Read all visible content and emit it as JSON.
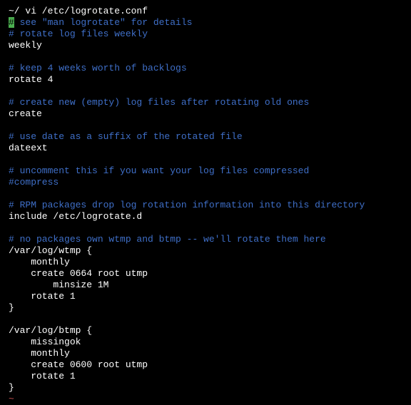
{
  "prompt": "~/ vi /etc/logrotate.conf",
  "cursor_char": "#",
  "l1_rest": " see \"man logrotate\" for details",
  "l2": "# rotate log files weekly",
  "l3": "weekly",
  "l4": "# keep 4 weeks worth of backlogs",
  "l5": "rotate 4",
  "l6": "# create new (empty) log files after rotating old ones",
  "l7": "create",
  "l8": "# use date as a suffix of the rotated file",
  "l9": "dateext",
  "l10": "# uncomment this if you want your log files compressed",
  "l11": "#compress",
  "l12": "# RPM packages drop log rotation information into this directory",
  "l13": "include /etc/logrotate.d",
  "l14": "# no packages own wtmp and btmp -- we'll rotate them here",
  "l15": "/var/log/wtmp {",
  "l16": "    monthly",
  "l17": "    create 0664 root utmp",
  "l18": "        minsize 1M",
  "l19": "    rotate 1",
  "l20": "}",
  "l21": "/var/log/btmp {",
  "l22": "    missingok",
  "l23": "    monthly",
  "l24": "    create 0600 root utmp",
  "l25": "    rotate 1",
  "l26": "}",
  "eof": "~"
}
